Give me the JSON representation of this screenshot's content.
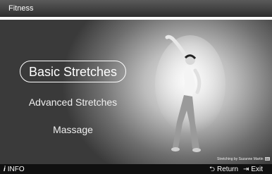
{
  "header": {
    "title": "Fitness"
  },
  "menu": {
    "items": [
      {
        "label": "Basic Stretches",
        "selected": true
      },
      {
        "label": "Advanced Stretches",
        "selected": false
      },
      {
        "label": "Massage",
        "selected": false
      }
    ]
  },
  "credit": {
    "text": "Stretching by Suzanne Martin",
    "badge": "DK"
  },
  "footer": {
    "info_label": "INFO",
    "return_label": "Return",
    "exit_label": "Exit"
  },
  "icons": {
    "info": "info-icon",
    "return": "return-arrow-icon",
    "exit": "exit-icon"
  },
  "colors": {
    "background": "#3a3a3a",
    "highlight": "#ffffff",
    "top_bar": "#444444"
  }
}
